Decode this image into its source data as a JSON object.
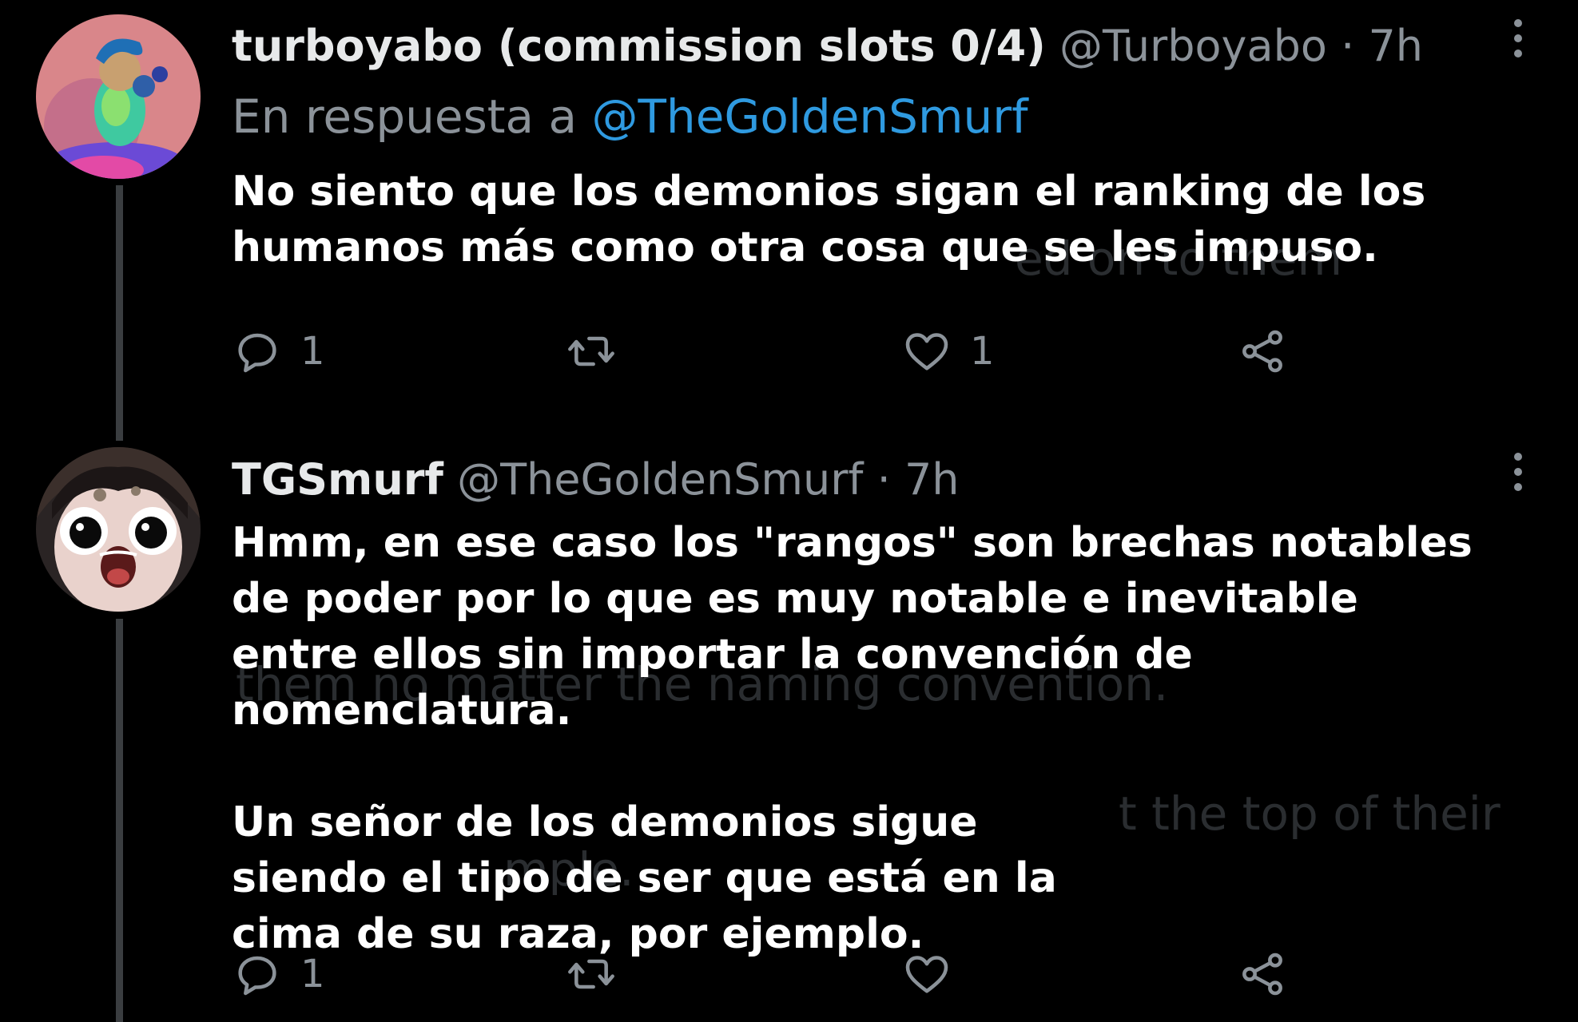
{
  "colors": {
    "background": "#000000",
    "muted_text": "#8b9299",
    "mention_link": "#2f9ae0",
    "thread_line": "#3a3d40"
  },
  "tweets": [
    {
      "display_name": "turboyabo (commission slots 0/4)",
      "handle": "@Turboyabo",
      "separator": "·",
      "time": "7h",
      "reply_prefix": "En respuesta a",
      "reply_mention": "@TheGoldenSmurf",
      "body_paragraphs": [
        "No siento que los demonios sigan el ranking de los humanos más como otra cosa que se les impuso."
      ],
      "ghost_text": "ed on to them",
      "actions": {
        "reply_icon": "speech-bubble-icon",
        "reply_count": "1",
        "retweet_icon": "retweet-arrows-icon",
        "retweet_count": "",
        "like_icon": "heart-icon",
        "like_count": "1",
        "share_icon": "share-icon"
      },
      "more_icon": "vertical-ellipsis-icon"
    },
    {
      "display_name": "TGSmurf",
      "handle": "@TheGoldenSmurf",
      "separator": "·",
      "time": "7h",
      "body_paragraphs": [
        "Hmm, en ese caso los \"rangos\" son brechas notables de poder por lo que es muy notable e inevitable entre ellos sin importar la convención de nomenclatura.",
        "Un señor de los demonios sigue siendo el tipo de ser que está en la cima de su raza, por ejemplo."
      ],
      "ghost_text_1": "them no matter the naming convention.",
      "ghost_text_2": "t the top of their",
      "ghost_text_3": "mple.",
      "actions": {
        "reply_icon": "speech-bubble-icon",
        "reply_count": "1",
        "retweet_icon": "retweet-arrows-icon",
        "retweet_count": "",
        "like_icon": "heart-icon",
        "like_count": "",
        "share_icon": "share-icon"
      },
      "more_icon": "vertical-ellipsis-icon"
    }
  ]
}
